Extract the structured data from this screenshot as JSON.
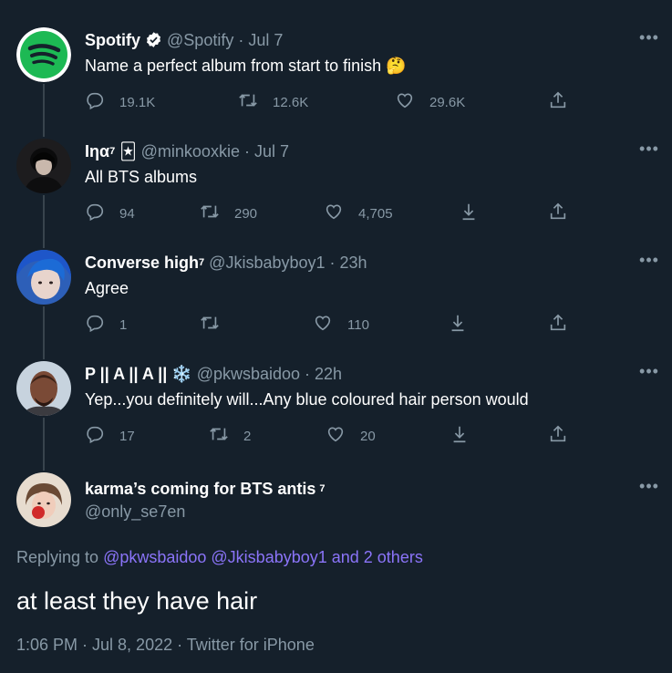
{
  "tweets": [
    {
      "name": "Spotify",
      "sup": "",
      "emoji": "verified",
      "handle": "@Spotify · Jul 7",
      "text": "Name a perfect album from start to finish 🤔",
      "reply_count": "19.1K",
      "retweet_count": "12.6K",
      "like_count": "29.6K"
    },
    {
      "name": "Iηα",
      "sup": "7",
      "emoji": "🃏",
      "handle": "@minkooxkie · Jul 7",
      "text": "All BTS albums",
      "reply_count": "94",
      "retweet_count": "290",
      "like_count": "4,705"
    },
    {
      "name": "Converse high",
      "sup": "7",
      "emoji": "",
      "handle": "@Jkisbabyboy1 · 23h",
      "text": "Agree",
      "reply_count": "1",
      "retweet_count": "",
      "like_count": "110"
    },
    {
      "name": "P || A || A ||",
      "sup": "",
      "emoji": "❄️",
      "handle": "@pkwsbaidoo · 22h",
      "text": "Yep...you definitely will...Any blue coloured hair person would",
      "reply_count": "17",
      "retweet_count": "2",
      "like_count": "20"
    }
  ],
  "main_tweet": {
    "name": "karma’s coming for BTS antis",
    "sup": "7",
    "handle": "@only_se7en",
    "replying_prefix": "Replying to",
    "replying_links": "@pkwsbaidoo @Jkisbabyboy1 and 2 others",
    "text": "at least they have hair",
    "meta": "1:06 PM · Jul 8, 2022 · Twitter for iPhone"
  },
  "colors": {
    "background": "#15202b",
    "secondary_text": "#8899a6",
    "link": "#8b74f9",
    "spotify_green": "#1db954"
  },
  "icons": {
    "reply": "reply-icon",
    "retweet": "retweet-icon",
    "like": "heart-icon",
    "share": "share-icon",
    "download": "download-icon",
    "more": "more-icon"
  }
}
